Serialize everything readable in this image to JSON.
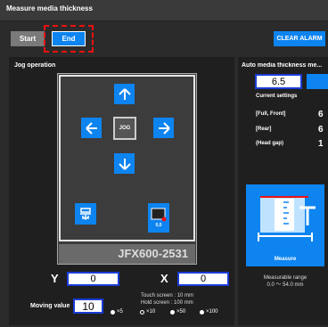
{
  "window": {
    "title": "Measure media thickness"
  },
  "toolbar": {
    "start_label": "Start",
    "end_label": "End",
    "clear_label": "CLEAR ALARM"
  },
  "jog": {
    "section_title": "Jog operation",
    "jog_label": "JOG",
    "origin_label": "0,0",
    "model_name": "JFX600-2531",
    "y_label": "Y",
    "y_value": "0",
    "x_label": "X",
    "x_value": "0",
    "moving_label": "Moving value",
    "moving_value": "10",
    "touch_note": "Touch screen : 10 mm",
    "hold_note": "Hold screen : 100 mm",
    "options": [
      "×5",
      "×10",
      "×50",
      "×100"
    ],
    "selected_option": "×10"
  },
  "auto": {
    "title": "Auto media thickness me...",
    "value": "6.5",
    "current_settings": "Current settings",
    "settings": [
      {
        "label": "[Full, Front]",
        "value": "6"
      },
      {
        "label": "[Rear]",
        "value": "6"
      },
      {
        "label": "(Head gap)",
        "value": "1"
      }
    ],
    "measure_label": "Measure",
    "range_label": "Measurable range",
    "range_value": "0.0 ～ 54.0 mm"
  },
  "colors": {
    "accent": "#0d84f0",
    "highlight": "#e11111"
  }
}
